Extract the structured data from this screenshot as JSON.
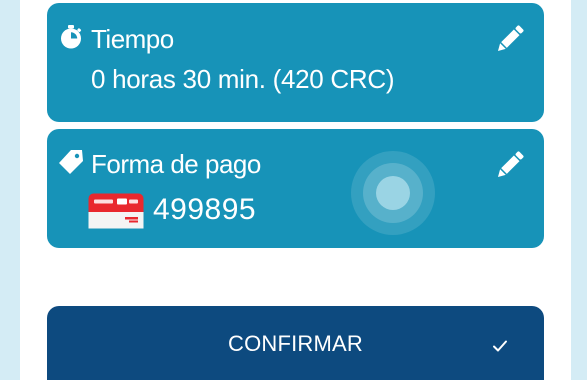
{
  "time_card": {
    "title": "Tiempo",
    "value": "0 horas 30 min. (420 CRC)",
    "icon": "stopwatch-icon",
    "edit_icon": "pencil-icon"
  },
  "payment_card": {
    "title": "Forma de pago",
    "card_number": "499895",
    "icon": "tag-icon",
    "card_logo": "credomatic-bac-card-logo",
    "edit_icon": "pencil-icon"
  },
  "confirm": {
    "label": "CONFIRMAR",
    "icon": "check-icon"
  },
  "colors": {
    "background": "#d4ecf5",
    "card": "#1793b8",
    "confirm_button": "#0d4a7f",
    "text": "#ffffff"
  }
}
